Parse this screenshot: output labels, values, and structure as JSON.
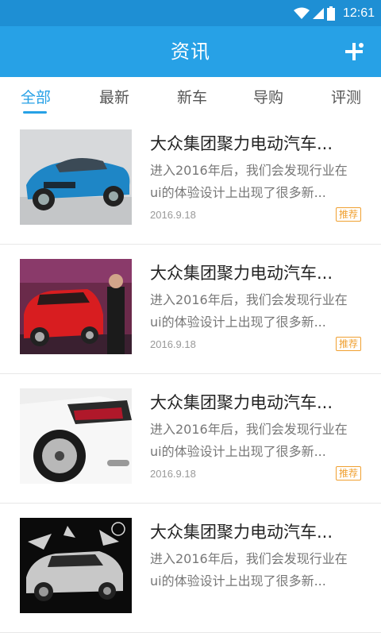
{
  "status_bar": {
    "time": "12:61"
  },
  "app_bar": {
    "title": "资讯"
  },
  "tabs": [
    {
      "label": "全部",
      "active": true
    },
    {
      "label": "最新",
      "active": false
    },
    {
      "label": "新车",
      "active": false
    },
    {
      "label": "导购",
      "active": false
    },
    {
      "label": "评测",
      "active": false
    }
  ],
  "news": [
    {
      "title": "大众集团聚力电动汽车...",
      "summary_line1": "进入2016年后，我们会发现行业在",
      "summary_line2": "ui的体验设计上出现了很多新...",
      "date": "2016.9.18",
      "badge": "推荐",
      "image": "blue-sports-sedan"
    },
    {
      "title": "大众集团聚力电动汽车...",
      "summary_line1": "进入2016年后，我们会发现行业在",
      "summary_line2": "ui的体验设计上出现了很多新...",
      "date": "2016.9.18",
      "badge": "推荐",
      "image": "red-hatchback-showroom"
    },
    {
      "title": "大众集团聚力电动汽车...",
      "summary_line1": "进入2016年后，我们会发现行业在",
      "summary_line2": "ui的体验设计上出现了很多新...",
      "date": "2016.9.18",
      "badge": "推荐",
      "image": "white-coupe-rear"
    },
    {
      "title": "大众集团聚力电动汽车...",
      "summary_line1": "进入2016年后，我们会发现行业在",
      "summary_line2": "ui的体验设计上出现了很多新...",
      "date": "",
      "badge": "",
      "image": "silver-suv-splash"
    }
  ],
  "colors": {
    "primary": "#27a1e6",
    "status_bar": "#1e8fd4",
    "badge": "#f0a030"
  }
}
